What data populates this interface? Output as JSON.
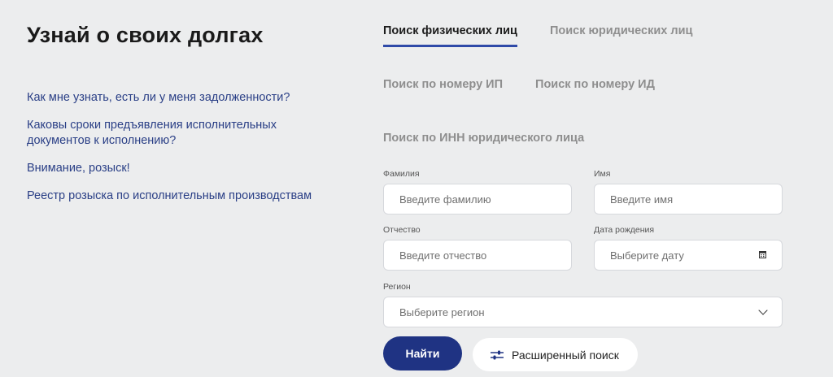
{
  "title": "Узнай о своих долгах",
  "faq": [
    "Как мне узнать, есть ли у меня задолженности?",
    "Каковы сроки предъявления исполнительных документов к исполнению?",
    "Внимание, розыск!",
    "Реестр розыска по исполнительным производствам"
  ],
  "tabs": {
    "individuals": "Поиск физических лиц",
    "legal": "Поиск юридических лиц"
  },
  "subtabs": {
    "ip": "Поиск по номеру ИП",
    "id": "Поиск по номеру ИД",
    "inn": "Поиск по ИНН юридического лица"
  },
  "form": {
    "surname": {
      "label": "Фамилия",
      "placeholder": "Введите фамилию"
    },
    "name": {
      "label": "Имя",
      "placeholder": "Введите имя"
    },
    "patronymic": {
      "label": "Отчество",
      "placeholder": "Введите отчество"
    },
    "birthdate": {
      "label": "Дата рождения",
      "placeholder": "Выберите дату"
    },
    "region": {
      "label": "Регион",
      "placeholder": "Выберите регион"
    }
  },
  "buttons": {
    "find": "Найти",
    "advanced": "Расширенный поиск"
  },
  "icons": {
    "calendar": "calendar-icon",
    "chevron": "chevron-down-icon",
    "filter": "sliders-icon"
  },
  "colors": {
    "accent": "#1f3383",
    "link": "#2a3f86",
    "tab_underline": "#2f4aa8"
  }
}
